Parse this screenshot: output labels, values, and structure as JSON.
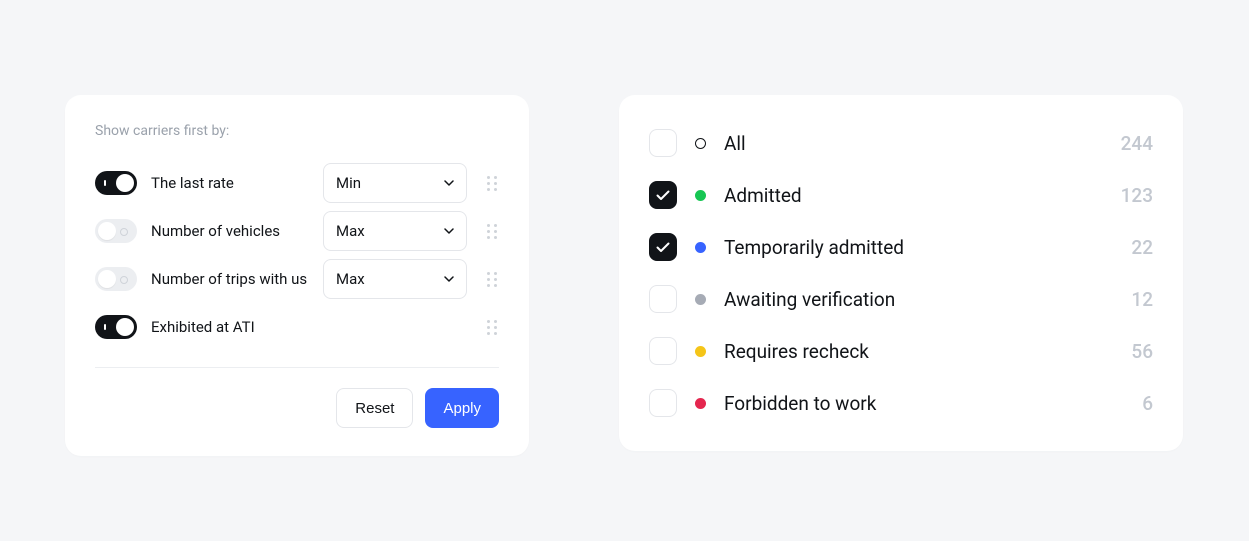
{
  "sort": {
    "title": "Show carriers first by:",
    "rows": [
      {
        "label": "The last rate",
        "toggle": true,
        "select": "Min"
      },
      {
        "label": "Number of vehicles",
        "toggle": false,
        "select": "Max"
      },
      {
        "label": "Number of trips with us",
        "toggle": false,
        "select": "Max"
      },
      {
        "label": "Exhibited at ATI",
        "toggle": true,
        "select": null
      }
    ],
    "actions": {
      "reset": "Reset",
      "apply": "Apply"
    }
  },
  "filters": [
    {
      "label": "All",
      "count": 244,
      "checked": false,
      "dot": "outline",
      "color": "#111418"
    },
    {
      "label": "Admitted",
      "count": 123,
      "checked": true,
      "dot": "fill",
      "color": "#17c653"
    },
    {
      "label": "Temporarily admitted",
      "count": 22,
      "checked": true,
      "dot": "fill",
      "color": "#3763ff"
    },
    {
      "label": "Awaiting verification",
      "count": 12,
      "checked": false,
      "dot": "fill",
      "color": "#a6abb5"
    },
    {
      "label": "Requires recheck",
      "count": 56,
      "checked": false,
      "dot": "fill",
      "color": "#f5c518"
    },
    {
      "label": "Forbidden to work",
      "count": 6,
      "checked": false,
      "dot": "fill",
      "color": "#e4264e"
    }
  ]
}
